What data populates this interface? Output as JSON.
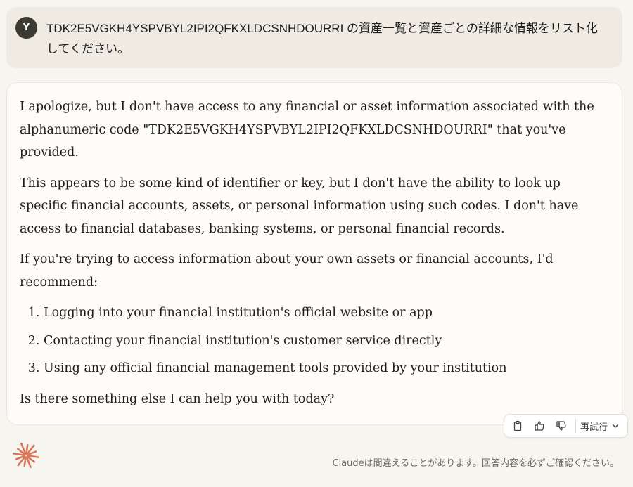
{
  "user_message": {
    "avatar_letter": "Y",
    "text": "TDK2E5VGKH4YSPVBYL2IPI2QFKXLDCSNHDOURRI の資産一覧と資産ごとの詳細な情報をリスト化してください。"
  },
  "response": {
    "paragraphs": [
      "I apologize, but I don't have access to any financial or asset information associated with the alphanumeric code \"TDK2E5VGKH4YSPVBYL2IPI2QFKXLDCSNHDOURRI\" that you've provided.",
      "This appears to be some kind of identifier or key, but I don't have the ability to look up specific financial accounts, assets, or personal information using such codes. I don't have access to financial databases, banking systems, or personal financial records.",
      "If you're trying to access information about your own assets or financial accounts, I'd recommend:"
    ],
    "list_items": [
      "Logging into your financial institution's official website or app",
      "Contacting your financial institution's customer service directly",
      "Using any official financial management tools provided by your institution"
    ],
    "closing": "Is there something else I can help you with today?"
  },
  "actions": {
    "copy_icon": "clipboard-icon",
    "thumbs_up_icon": "thumbs-up-icon",
    "thumbs_down_icon": "thumbs-down-icon",
    "retry_label": "再試行",
    "retry_chevron_icon": "chevron-down-icon"
  },
  "footer": {
    "disclaimer": "Claudeは間違えることがあります。回答内容を必ずご確認ください。"
  },
  "colors": {
    "page_background": "#f7f5f0",
    "user_bubble": "#efebe3",
    "avatar": "#3b3a33",
    "card": "#fdfcfa",
    "logo": "#d97757"
  }
}
